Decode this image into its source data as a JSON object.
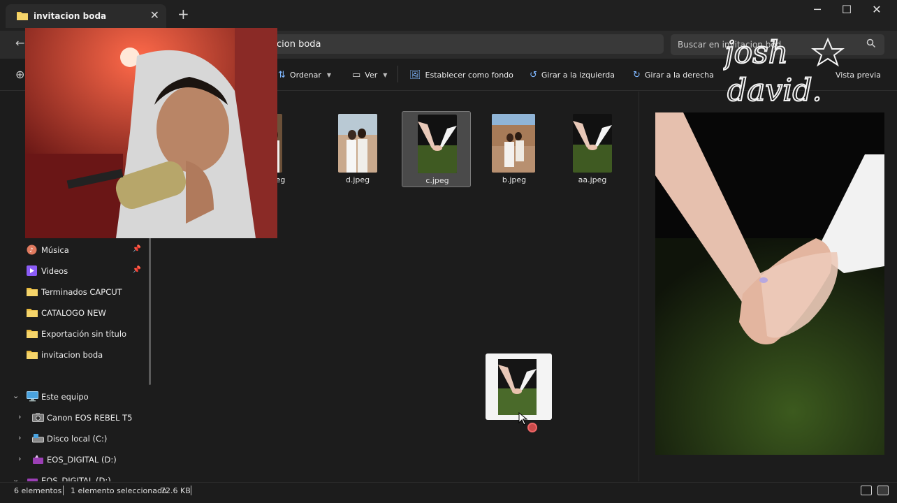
{
  "window": {
    "tab_title": "invitacion boda",
    "new_tab": "+",
    "controls": {
      "minimize": "─",
      "maximize": "☐",
      "close": "✕"
    }
  },
  "address": {
    "path": "cion boda",
    "search_placeholder": "Buscar en invitacion bod"
  },
  "toolbar": {
    "sort_label": "Ordenar",
    "view_label": "Ver",
    "set_background_label": "Establecer como fondo",
    "rotate_left_label": "Girar a la izquierda",
    "rotate_right_label": "Girar a la derecha",
    "preview_label": "Vista previa"
  },
  "sidebar": {
    "items": [
      {
        "label": "Música",
        "icon": "music-icon",
        "pinned": true
      },
      {
        "label": "Videos",
        "icon": "videos-icon",
        "pinned": true
      },
      {
        "label": "Terminados CAPCUT",
        "icon": "folder-icon"
      },
      {
        "label": "CATALOGO NEW",
        "icon": "folder-icon"
      },
      {
        "label": "Exportación sin título",
        "icon": "folder-icon"
      },
      {
        "label": "invitacion boda",
        "icon": "folder-icon"
      },
      {
        "label": "Este equipo",
        "icon": "computer-icon",
        "expanded": true
      },
      {
        "label": "Canon EOS REBEL T5",
        "icon": "camera-icon"
      },
      {
        "label": "Disco local (C:)",
        "icon": "drive-icon"
      },
      {
        "label": "EOS_DIGITAL (D:)",
        "icon": "sd-card-icon"
      },
      {
        "label": "EOS_DIGITAL (D:)",
        "icon": "sd-card-icon"
      }
    ]
  },
  "files": [
    {
      "name": "peg",
      "selected": false
    },
    {
      "name": "d.jpeg",
      "selected": false
    },
    {
      "name": "c.jpeg",
      "selected": true
    },
    {
      "name": "b.jpeg",
      "selected": false
    },
    {
      "name": "aa.jpeg",
      "selected": false
    }
  ],
  "status": {
    "count": "6 elementos",
    "selection": "1 elemento seleccionado",
    "size": "72.6 KB"
  },
  "watermark": {
    "line1": "josh",
    "line2": "david."
  },
  "colors": {
    "accent": "#7fb7ff",
    "folder": "#f2c94c",
    "background": "#1c1c1c",
    "no_drop": "#c94a4a"
  }
}
